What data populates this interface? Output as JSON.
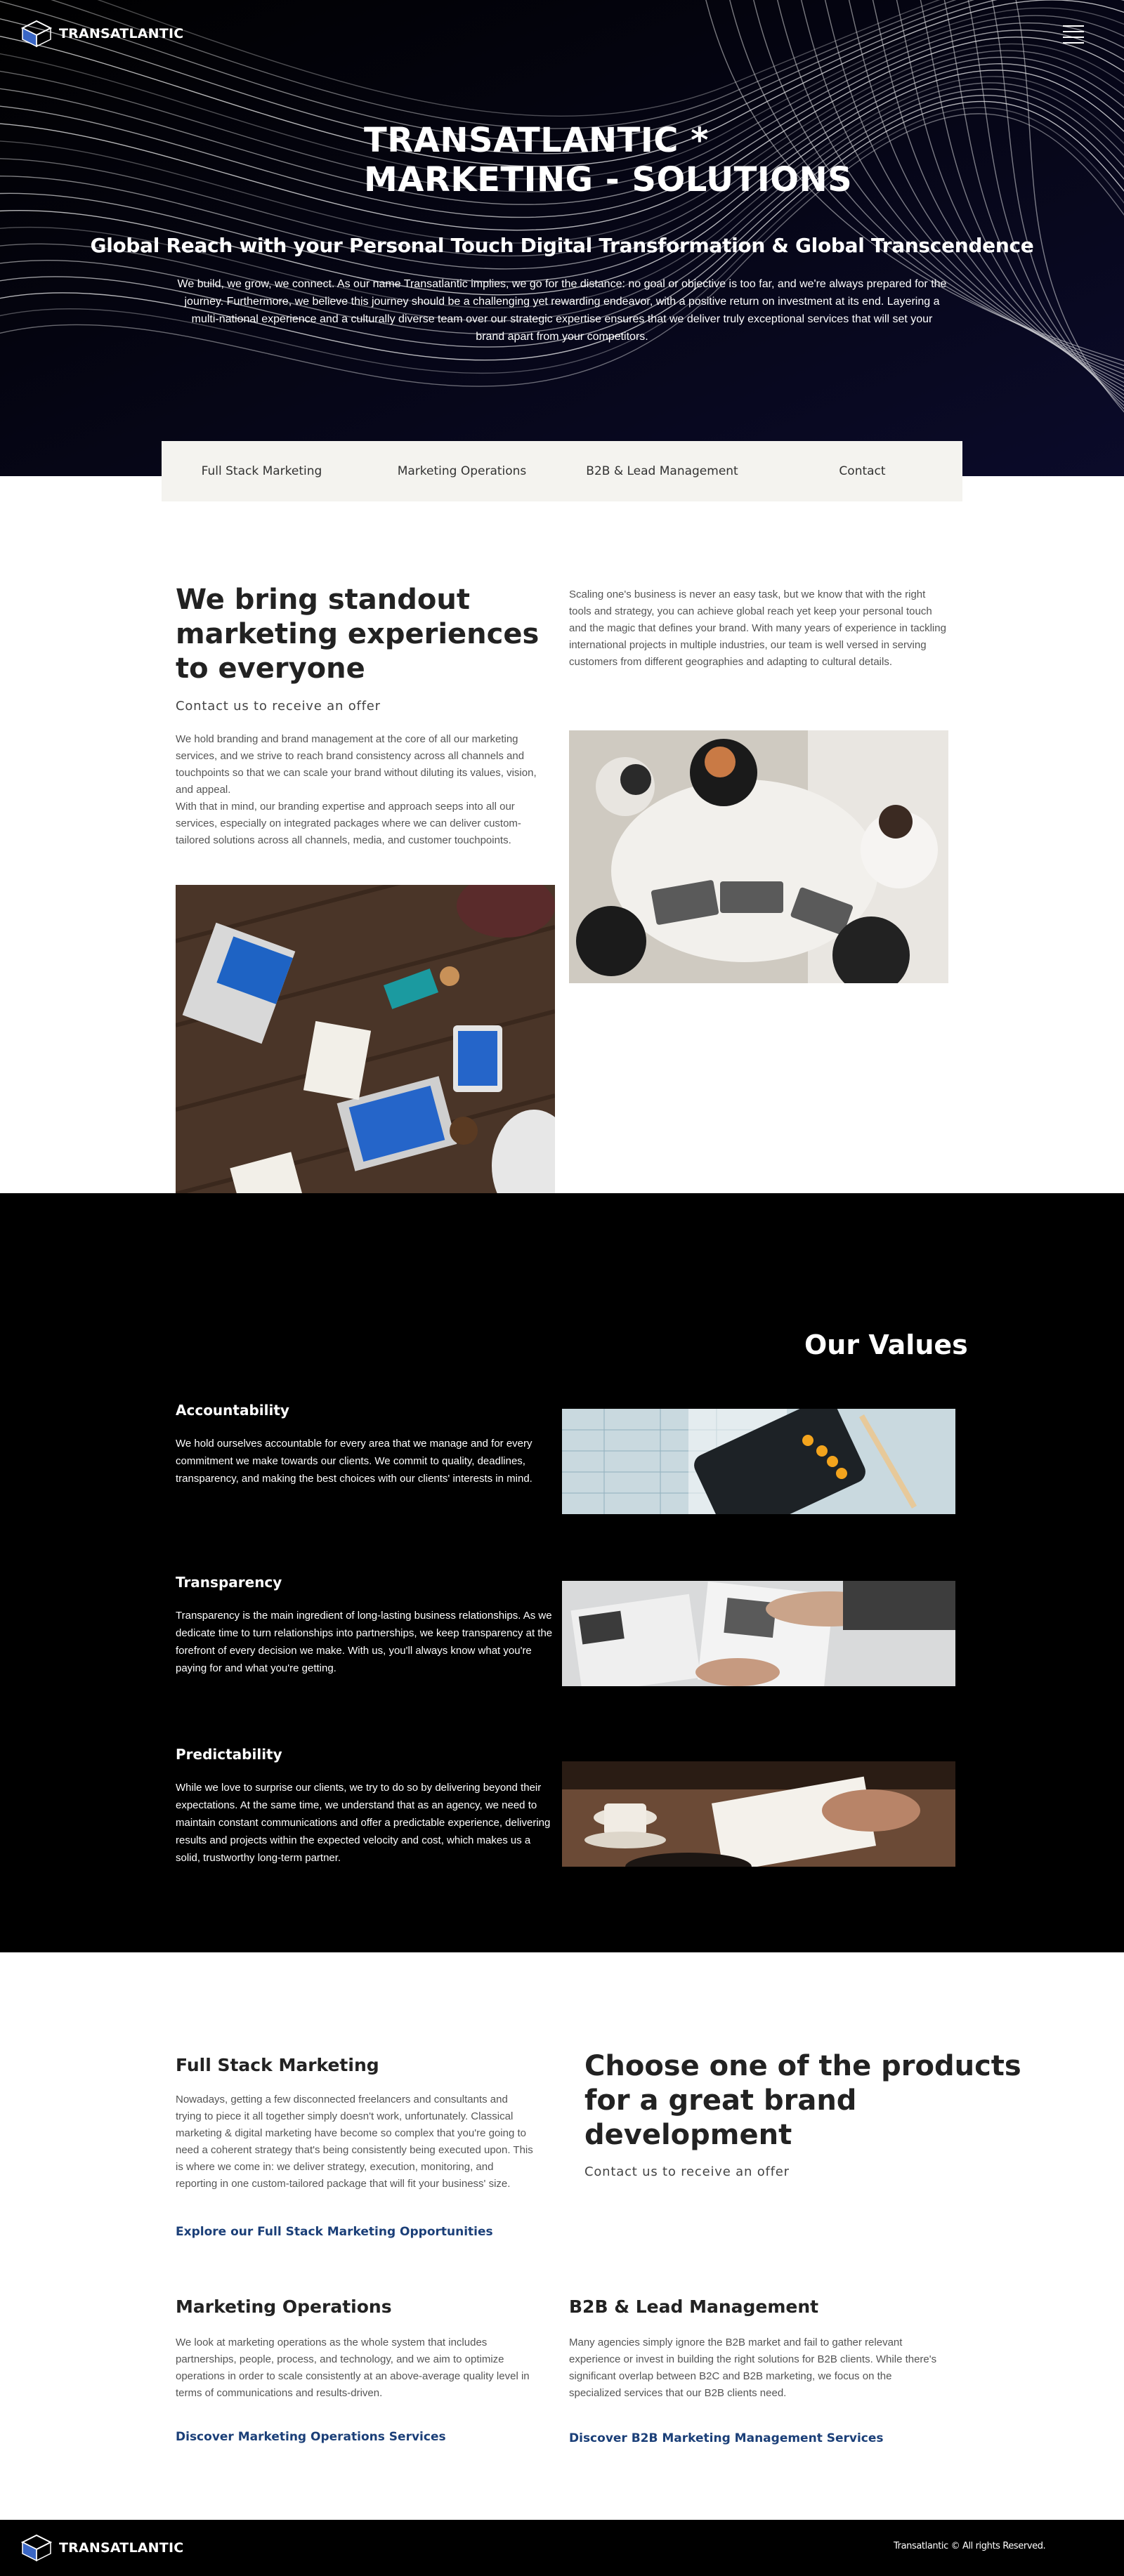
{
  "brand": {
    "logo_text": "TRANSATLANTIC"
  },
  "header": {
    "menu_icon": "hamburger-menu-icon"
  },
  "hero": {
    "title_line1": "TRANSATLANTIC *",
    "title_line2": "MARKETING - SOLUTIONS",
    "subtitle": "Global Reach with your Personal Touch Digital Transformation & Global Transcendence",
    "description": "We build, we grow, we connect. As our name Transatlantic implies, we go for the distance: no goal or objective is too far, and we're always prepared for the journey. Furthermore, we believe this journey should be a challenging yet rewarding endeavor, with a positive return on investment at its end. Layering a multi-national experience and a culturally diverse team over our strategic expertise ensures that we deliver truly exceptional services that will set your brand apart from your competitors."
  },
  "tabs": [
    {
      "label": "Full Stack Marketing"
    },
    {
      "label": "Marketing Operations"
    },
    {
      "label": "B2B & Lead Management"
    },
    {
      "label": "Contact"
    }
  ],
  "intro": {
    "heading_line1": "We bring standout",
    "heading_line2": "marketing experiences",
    "heading_line3": "to everyone",
    "cta": "Contact us to receive an offer",
    "left_text": "We hold branding and brand management at the core of all our marketing services, and we strive to reach brand consistency across all channels and touchpoints so that we can scale your brand without diluting its values, vision, and appeal.\nWith that in mind, our branding expertise and approach seeps into all our services, especially on integrated packages where we can deliver custom-tailored solutions across all channels, media, and customer touchpoints.",
    "right_text": "Scaling one's business is never an easy task, but we know that with the right tools and strategy, you can achieve global reach yet keep your personal touch and the magic that defines your brand. With many years of experience in tackling international projects in multiple industries, our team is well versed in serving customers from different geographies and adapting to cultural details."
  },
  "values": {
    "title": "Our Values",
    "items": [
      {
        "heading": "Accountability",
        "text": "We hold ourselves accountable for every area that we manage and for every commitment we make towards our clients. We commit to quality, deadlines, transparency, and making the best choices with our clients' interests in mind."
      },
      {
        "heading": "Transparency",
        "text": "Transparency is the main ingredient of long-lasting business relationships. As we dedicate time to turn relationships into partnerships, we keep transparency at the forefront of every decision we make. With us, you'll always know what you're paying for and what you're getting."
      },
      {
        "heading": "Predictability",
        "text": "While we love to surprise our clients, we try to do so by delivering beyond their expectations. At the same time, we understand that as an agency, we need to maintain constant communications and offer a predictable experience, delivering results and projects within the expected velocity and cost, which makes us a solid, trustworthy long-term partner."
      }
    ]
  },
  "products": {
    "choose_line1": "Choose one of the products",
    "choose_line2": "for a great brand",
    "choose_line3": "development",
    "cta": "Contact us to receive an offer",
    "full_stack": {
      "heading": "Full Stack Marketing",
      "text": "Nowadays, getting a few disconnected freelancers and consultants and trying to piece it all together simply doesn't work, unfortunately. Classical marketing & digital marketing have become so complex that you're going to need a coherent strategy that's being consistently being executed upon. This is where we come in: we deliver strategy, execution, monitoring, and reporting in one custom-tailored package that will fit your business' size.",
      "link": "Explore our Full Stack Marketing Opportunities"
    },
    "operations": {
      "heading": "Marketing Operations",
      "text": "We look at marketing operations as the whole system that includes partnerships, people, process, and technology, and we aim to optimize operations in order to scale consistently at an above-average quality level in terms of communications and results-driven.",
      "link": "Discover Marketing Operations Services"
    },
    "b2b": {
      "heading": "B2B & Lead Management",
      "text": "Many agencies simply ignore the B2B market and fail to gather relevant experience or invest in building the right solutions for B2B clients. While there's significant overlap between B2C and B2B marketing, we focus on the specialized services that our B2B clients need.",
      "link": "Discover B2B Marketing Management Services"
    }
  },
  "footer": {
    "copyright": "Transatlantic © All rights Reserved."
  }
}
